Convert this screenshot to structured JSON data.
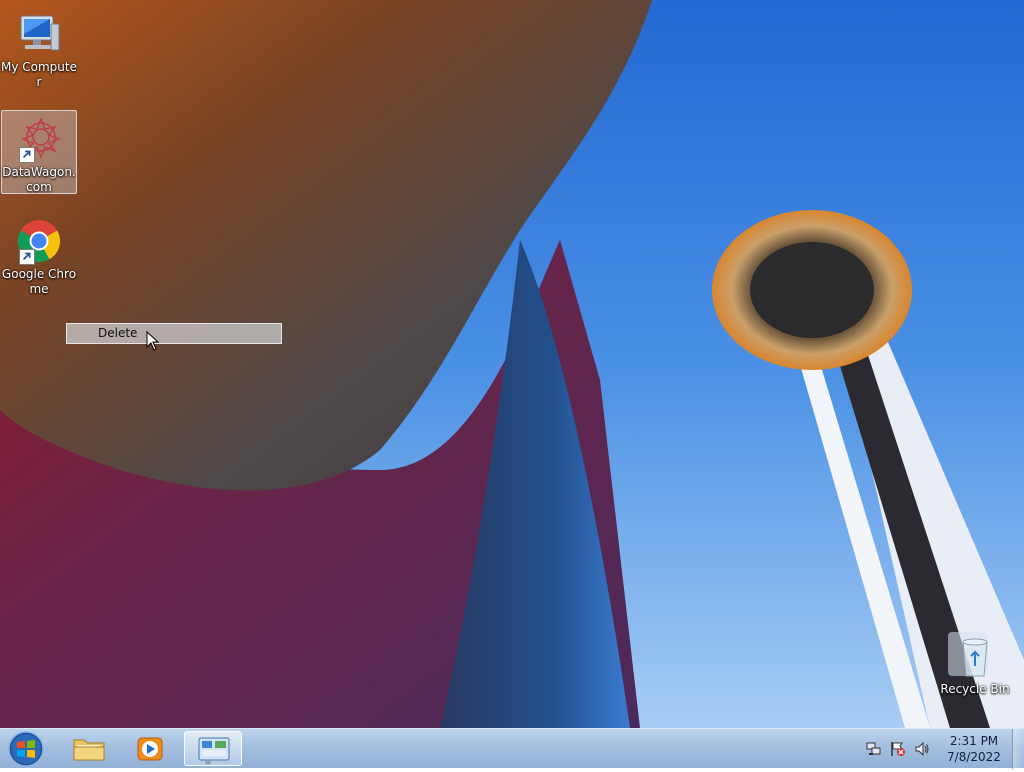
{
  "desktop": {
    "icons": [
      {
        "label": "My Computer",
        "icon": "computer-icon"
      },
      {
        "label": "DataWagon.com",
        "icon": "datawagon-icon",
        "selected": true
      },
      {
        "label": "Google Chrome",
        "icon": "chrome-icon"
      },
      {
        "label": "Recycle Bin",
        "icon": "recycle-bin-icon"
      }
    ]
  },
  "context_menu": {
    "items": [
      {
        "label": "Delete"
      }
    ]
  },
  "taskbar": {
    "pinned": [
      {
        "name": "Windows Explorer",
        "icon": "folder-icon"
      },
      {
        "name": "Windows Media Player",
        "icon": "media-player-icon"
      },
      {
        "name": "Control Panel",
        "icon": "control-panel-icon",
        "active": true
      }
    ],
    "tray": [
      "network-icon",
      "action-center-icon",
      "volume-icon"
    ],
    "clock": {
      "time": "2:31 PM",
      "date": "7/8/2022"
    }
  },
  "colors": {
    "sky": "#3b7fe0",
    "needle_halo": "#d7903a",
    "building_orange": "#c45a1a",
    "taskbar": "#a9c3e2"
  }
}
